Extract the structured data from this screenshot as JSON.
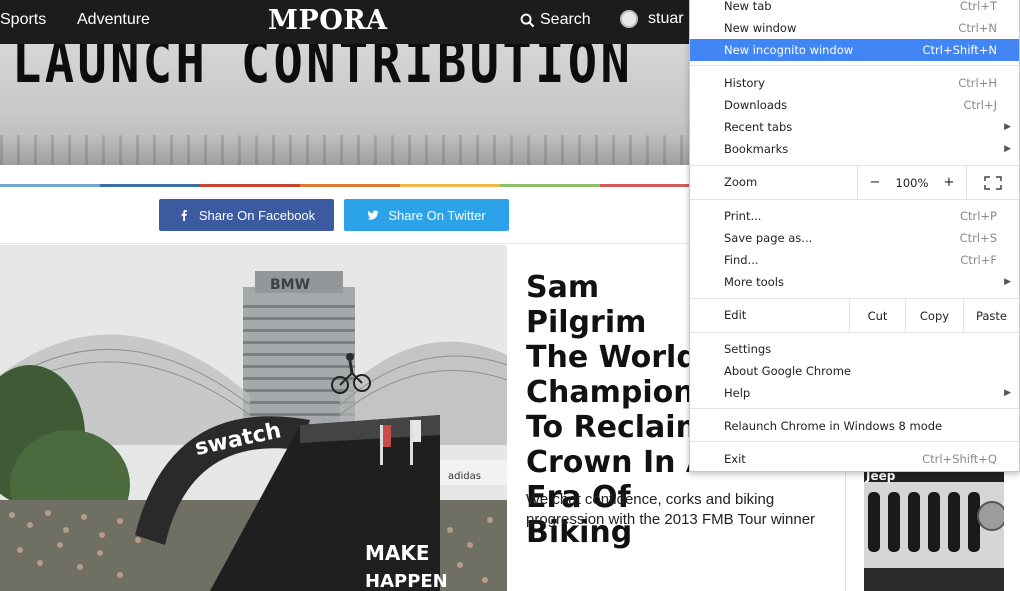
{
  "header": {
    "nav": [
      "Sports",
      "Adventure"
    ],
    "logo": "MPORA",
    "search_label": "Search",
    "user_name": "stuar"
  },
  "hero": {
    "title": "LAUNCH CONTRIBUTION"
  },
  "share": {
    "facebook_label": "Share On Facebook",
    "twitter_label": "Share On Twitter"
  },
  "article": {
    "title": "Sam Pilgrim\nThe World\nChampion\nTo Reclaim\nCrown In A\nEra Of Biking",
    "subtitle": "We chat confidence, corks and biking progression with the 2013 FMB Tour winner",
    "image_sign_1": "swatch",
    "image_sign_2": "MAKE",
    "image_sign_3": "HAPPEN",
    "image_sign_4": "adidas",
    "image_sign_5": "BMW"
  },
  "ad": {
    "brand": "Jeep"
  },
  "chrome_menu": {
    "items": [
      {
        "label": "New tab",
        "shortcut": "Ctrl+T"
      },
      {
        "label": "New window",
        "shortcut": "Ctrl+N"
      },
      {
        "label": "New incognito window",
        "shortcut": "Ctrl+Shift+N"
      },
      {
        "label": "History",
        "shortcut": "Ctrl+H"
      },
      {
        "label": "Downloads",
        "shortcut": "Ctrl+J"
      },
      {
        "label": "Recent tabs",
        "shortcut": ""
      },
      {
        "label": "Bookmarks",
        "shortcut": ""
      },
      {
        "label": "Print...",
        "shortcut": "Ctrl+P"
      },
      {
        "label": "Save page as...",
        "shortcut": "Ctrl+S"
      },
      {
        "label": "Find...",
        "shortcut": "Ctrl+F"
      },
      {
        "label": "More tools",
        "shortcut": ""
      },
      {
        "label": "Settings",
        "shortcut": ""
      },
      {
        "label": "About Google Chrome",
        "shortcut": ""
      },
      {
        "label": "Help",
        "shortcut": ""
      },
      {
        "label": "Relaunch Chrome in Windows 8 mode",
        "shortcut": ""
      },
      {
        "label": "Exit",
        "shortcut": "Ctrl+Shift+Q"
      }
    ],
    "zoom": {
      "label": "Zoom",
      "minus": "−",
      "value": "100%",
      "plus": "+"
    },
    "edit": {
      "label": "Edit",
      "cut": "Cut",
      "copy": "Copy",
      "paste": "Paste"
    },
    "highlight_color": "#4285f4"
  },
  "colors": {
    "header_bg": "#1c1c1c",
    "facebook": "#3b5a9f",
    "twitter": "#2ca3e9",
    "strip": [
      "#6fa7d3",
      "#3a6fa8",
      "#c8432f",
      "#e07a35",
      "#f0b94a",
      "#8fbf6a",
      "#d15a5a"
    ]
  }
}
